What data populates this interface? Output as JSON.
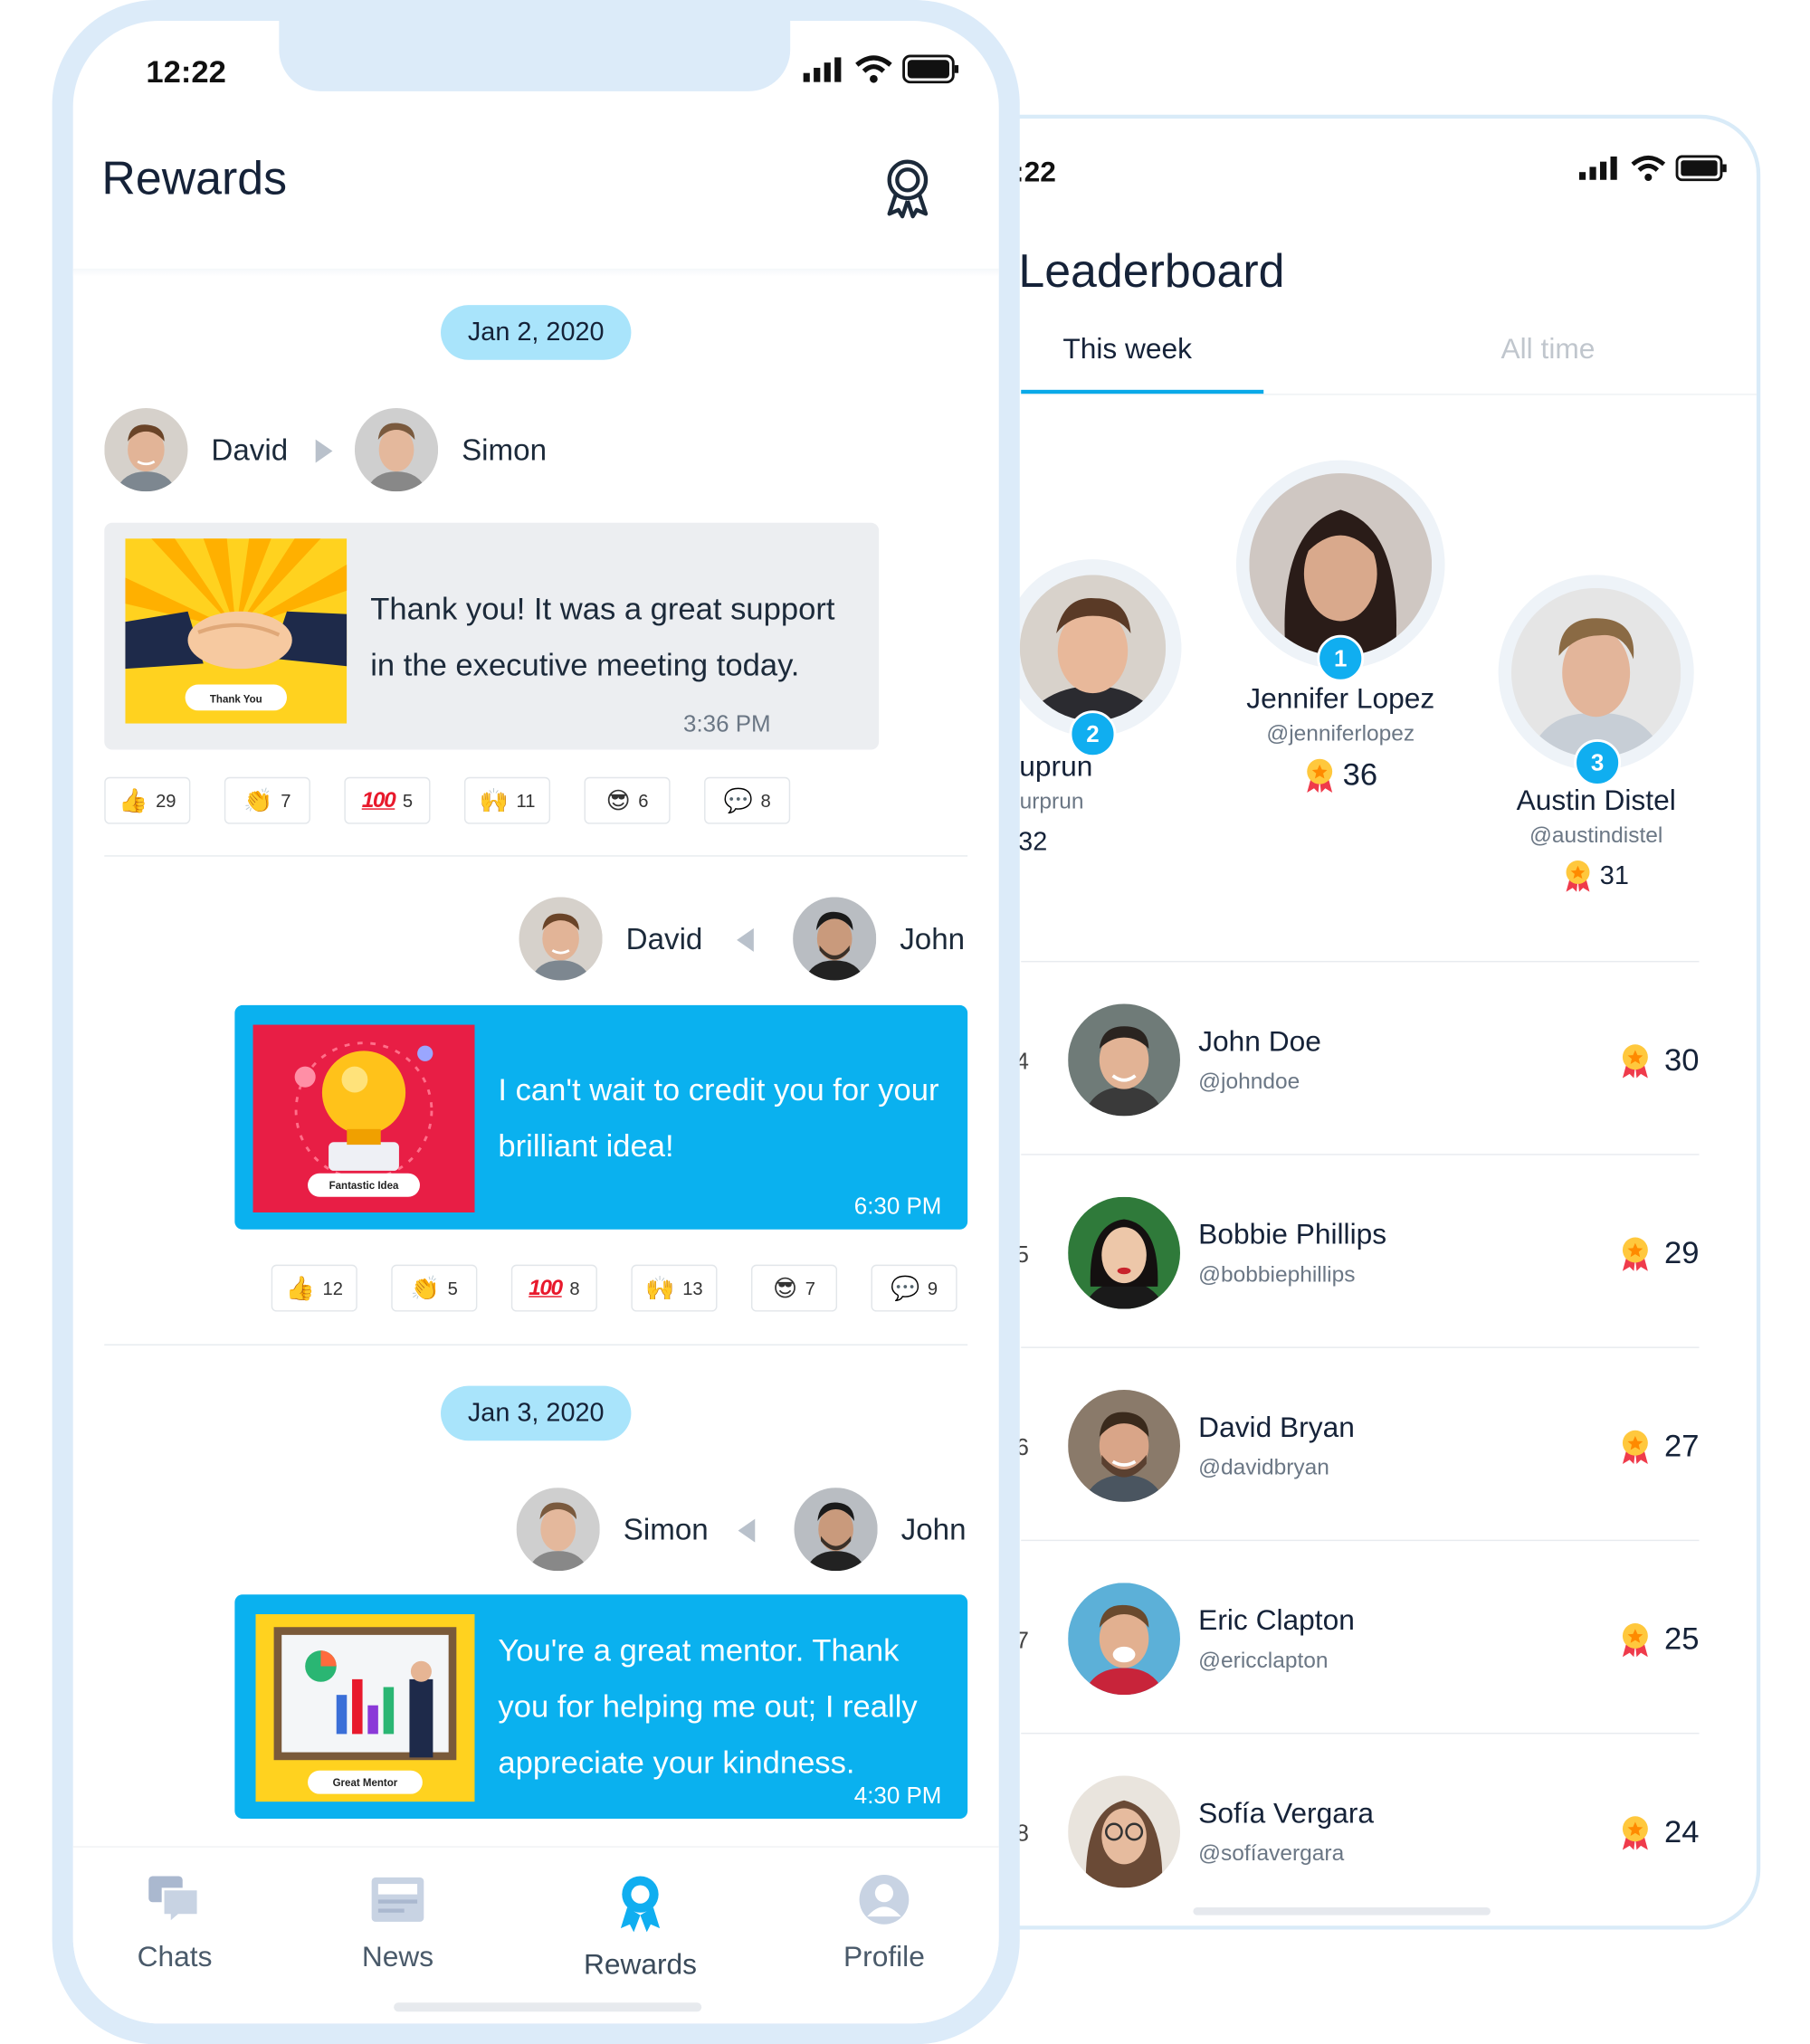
{
  "leaderboard": {
    "time": ":22",
    "title": "Leaderboard",
    "tabs": {
      "active": "This week",
      "inactive": "All time"
    },
    "podium": [
      {
        "rank": "2",
        "name": "Alex Suprun",
        "handle": "@alexsurprun",
        "score": "32"
      },
      {
        "rank": "1",
        "name": "Jennifer Lopez",
        "handle": "@jenniferlopez",
        "score": "36"
      },
      {
        "rank": "3",
        "name": "Austin Distel",
        "handle": "@austindistel",
        "score": "31"
      }
    ],
    "rows": [
      {
        "rank": "4",
        "name": "John Doe",
        "handle": "@johndoe",
        "score": "30"
      },
      {
        "rank": "5",
        "name": "Bobbie Phillips",
        "handle": "@bobbiephillips",
        "score": "29"
      },
      {
        "rank": "6",
        "name": "David Bryan",
        "handle": "@davidbryan",
        "score": "27"
      },
      {
        "rank": "7",
        "name": "Eric Clapton",
        "handle": "@ericclapton",
        "score": "25"
      },
      {
        "rank": "8",
        "name": "Sofía Vergara",
        "handle": "@sofíavergara",
        "score": "24"
      }
    ]
  },
  "rewards": {
    "time": "12:22",
    "title": "Rewards",
    "dates": [
      "Jan 2, 2020",
      "Jan 3, 2020"
    ],
    "messages": [
      {
        "from": "David",
        "to": "Simon",
        "text_line1": "Thank you! It was a great  support",
        "text_line2": "in the executive meeting today.",
        "time": "3:36 PM",
        "card_caption": "Thank You",
        "reactions": [
          "29",
          "7",
          "5",
          "11",
          "6",
          "8"
        ]
      },
      {
        "from": "David",
        "to": "John",
        "text_line1": "I can't wait to credit you for your",
        "text_line2": "brilliant idea!",
        "time": "6:30 PM",
        "card_caption": "Fantastic Idea",
        "reactions": [
          "12",
          "5",
          "8",
          "13",
          "7",
          "9"
        ]
      },
      {
        "from": "Simon",
        "to": "John",
        "text_line1": "You're a great mentor. Thank",
        "text_line2": "you for helping me out; I really",
        "text_line3": "appreciate your kindness.",
        "time": "4:30 PM",
        "card_caption": "Great Mentor"
      }
    ],
    "tabbar": [
      "Chats",
      "News",
      "Rewards",
      "Profile"
    ],
    "reaction_icons": [
      "thumbs-up-icon",
      "clapping-hands-icon",
      "hundred-points-icon",
      "raised-hands-icon",
      "sunglasses-face-icon",
      "speech-bubble-icon"
    ]
  },
  "colors": {
    "accent": "#0ab1ef",
    "date_pill": "#a9e4fb",
    "frame": "#dcebf9"
  }
}
